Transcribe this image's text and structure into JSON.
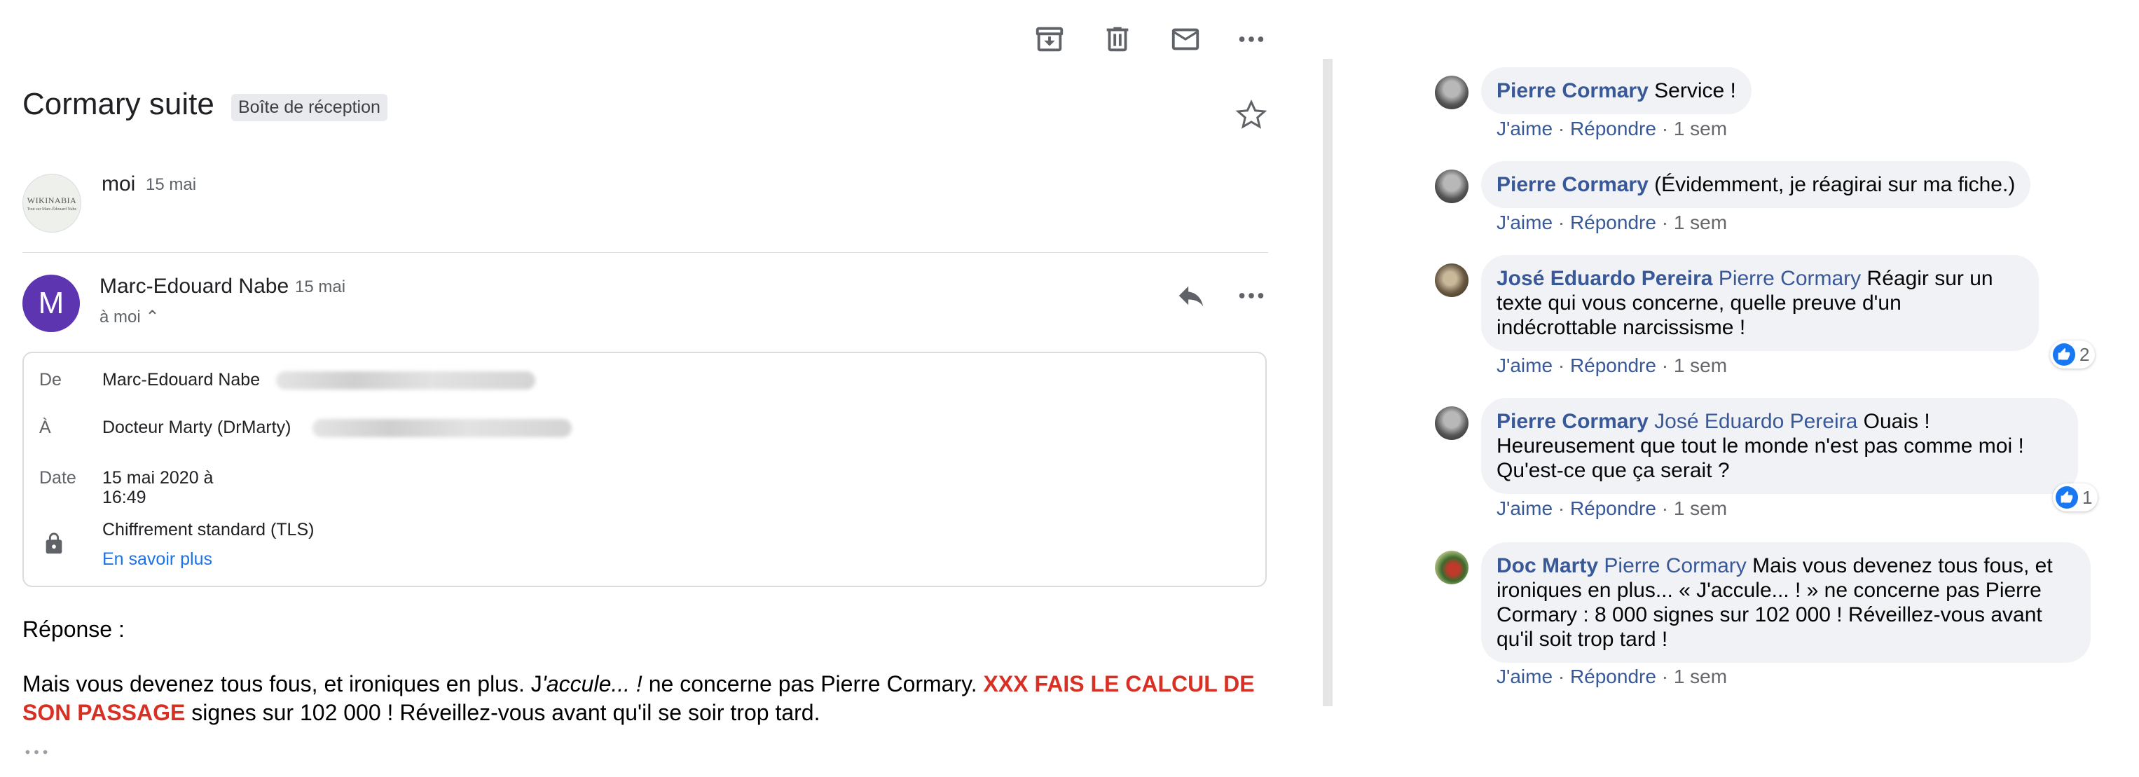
{
  "toolbar": {
    "archive_icon": "archive-icon",
    "delete_icon": "trash-icon",
    "mark_unread_icon": "mail-icon",
    "more_icon": "more-horizontal-icon"
  },
  "email": {
    "subject": "Cormary suite",
    "label": "Boîte de réception",
    "thread": [
      {
        "sender": "moi",
        "date": "15 mai",
        "avatar_text_1": "WIKINABIA",
        "avatar_text_2": "Tout sur Marc-Édouard Nabe"
      },
      {
        "sender": "Marc-Edouard Nabe",
        "date": "15 mai",
        "avatar_letter": "M",
        "recipient_summary": "à moi ⌃"
      }
    ],
    "details": {
      "from_label": "De",
      "from_value": "Marc-Edouard Nabe",
      "to_label": "À",
      "to_value": "Docteur Marty (DrMarty)",
      "date_label": "Date",
      "date_value_line1": "15 mai 2020 à",
      "date_value_line2": "16:49",
      "encryption": "Chiffrement standard (TLS)",
      "learn_more": "En savoir plus"
    },
    "body": {
      "greeting": "Réponse :",
      "p1": "Mais vous devenez tous fous, et ironiques en plus. J",
      "p1_italic": "'accule... !",
      "p2": " ne concerne pas Pierre Cormary. ",
      "highlight": "XXX FAIS LE CALCUL DE SON PASSAGE",
      "p3": " signes sur 102 000 ! Réveillez-vous avant qu'il se soir trop tard."
    }
  },
  "comments": [
    {
      "author": "Pierre Cormary",
      "mention": "",
      "text": "Service !",
      "like": "J'aime",
      "reply": "Répondre",
      "time": "1 sem",
      "reactions": ""
    },
    {
      "author": "Pierre Cormary",
      "mention": "",
      "text": "(Évidemment, je réagirai sur ma fiche.)",
      "like": "J'aime",
      "reply": "Répondre",
      "time": "1 sem",
      "reactions": ""
    },
    {
      "author": "José Eduardo Pereira",
      "mention": "Pierre Cormary",
      "text": "Réagir sur un texte qui vous concerne, quelle preuve d'un indécrottable narcissisme !",
      "like": "J'aime",
      "reply": "Répondre",
      "time": "1 sem",
      "reactions": "2"
    },
    {
      "author": "Pierre Cormary",
      "mention": "José Eduardo Pereira",
      "text": "Ouais ! Heureusement que tout le monde n'est pas comme moi ! Qu'est-ce que ça serait ?",
      "like": "J'aime",
      "reply": "Répondre",
      "time": "1 sem",
      "reactions": "1"
    },
    {
      "author": "Doc Marty",
      "mention": "Pierre Cormary",
      "text": "Mais vous devenez tous fous, et ironiques en plus... « J'accule... ! » ne concerne pas Pierre Cormary : 8 000 signes sur 102 000 ! Réveillez-vous avant qu'il soit trop tard !",
      "like": "J'aime",
      "reply": "Répondre",
      "time": "1 sem",
      "reactions": ""
    }
  ],
  "colors": {
    "fb_link": "#385898",
    "gmail_link": "#1a73e8",
    "avatar_m": "#5e35b1",
    "highlight_red": "#d93025"
  }
}
